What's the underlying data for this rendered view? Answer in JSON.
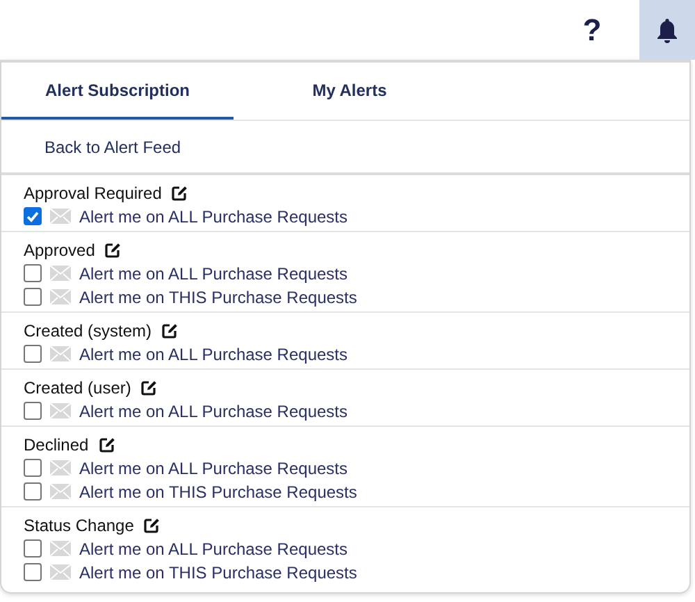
{
  "topbar": {
    "help": "?",
    "bell_active": true
  },
  "tabs": [
    {
      "label": "Alert Subscription",
      "selected": true
    },
    {
      "label": "My Alerts",
      "selected": false
    }
  ],
  "back_link": "Back to Alert Feed",
  "groups": [
    {
      "title": "Approval Required",
      "options": [
        {
          "label": "Alert me on ALL Purchase Requests",
          "checked": true
        }
      ]
    },
    {
      "title": "Approved",
      "options": [
        {
          "label": "Alert me on ALL Purchase Requests",
          "checked": false
        },
        {
          "label": "Alert me on THIS Purchase Requests",
          "checked": false
        }
      ]
    },
    {
      "title": "Created (system)",
      "options": [
        {
          "label": "Alert me on ALL Purchase Requests",
          "checked": false
        }
      ]
    },
    {
      "title": "Created (user)",
      "options": [
        {
          "label": "Alert me on ALL Purchase Requests",
          "checked": false
        }
      ]
    },
    {
      "title": "Declined",
      "options": [
        {
          "label": "Alert me on ALL Purchase Requests",
          "checked": false
        },
        {
          "label": "Alert me on THIS Purchase Requests",
          "checked": false
        }
      ]
    },
    {
      "title": "Status Change",
      "options": [
        {
          "label": "Alert me on ALL Purchase Requests",
          "checked": false
        },
        {
          "label": "Alert me on THIS Purchase Requests",
          "checked": false
        }
      ]
    }
  ]
}
